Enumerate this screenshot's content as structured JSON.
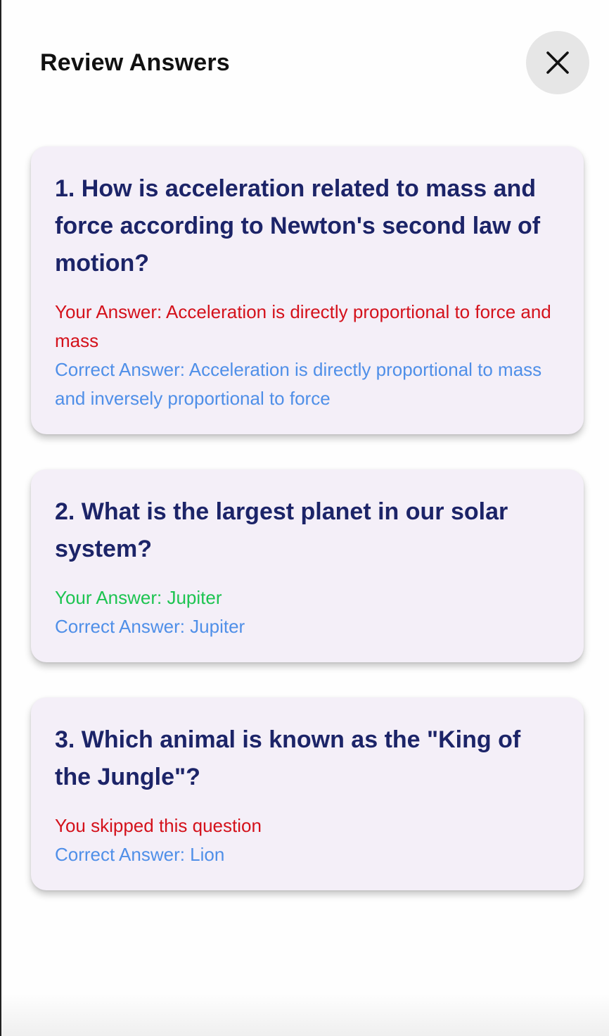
{
  "header": {
    "title": "Review Answers",
    "close_icon": "close-icon"
  },
  "colors": {
    "question_text": "#1c2468",
    "wrong_answer": "#d4111b",
    "right_answer": "#1dc451",
    "correct_answer": "#4f8fe8",
    "card_background": "#f4eff8",
    "close_button_background": "#e6e6e6"
  },
  "questions": [
    {
      "question": "1. How is acceleration related to mass and force according to Newton's second law of motion?",
      "user_answer": "Your Answer: Acceleration is directly proportional to force and mass",
      "status": "wrong",
      "correct_answer": "Correct Answer: Acceleration is directly proportional to mass and inversely proportional to force"
    },
    {
      "question": "2. What is the largest planet in our solar system?",
      "user_answer": "Your Answer: Jupiter",
      "status": "right",
      "correct_answer": "Correct Answer: Jupiter"
    },
    {
      "question": "3. Which animal is known as the \"King of the Jungle\"?",
      "user_answer": "You skipped this question",
      "status": "skipped",
      "correct_answer": "Correct Answer: Lion"
    }
  ]
}
